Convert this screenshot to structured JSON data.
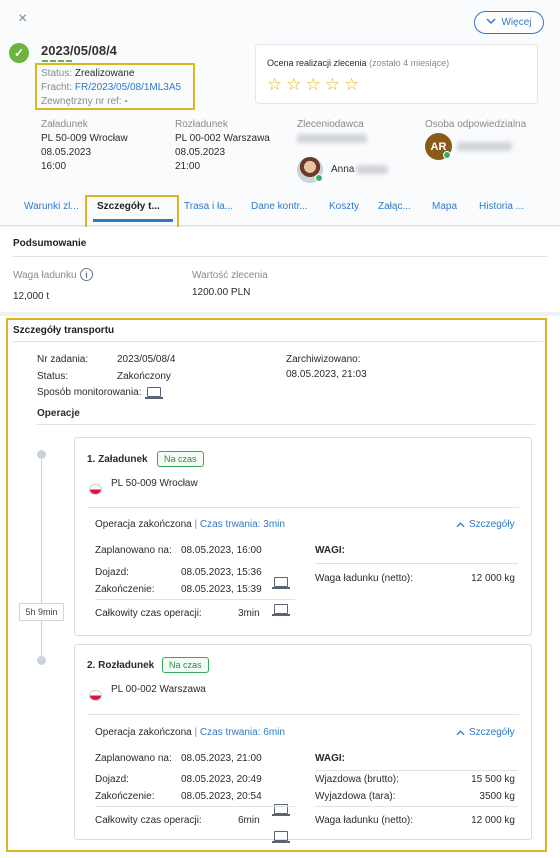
{
  "header": {
    "close_icon": "×",
    "more_label": "Więcej",
    "order_number": "2023/05/08/4",
    "status_label": "Status:",
    "status_value": "Zrealizowane",
    "freight_label": "Fracht:",
    "freight_value": "FR/2023/05/08/1ML3A5",
    "ext_ref_label": "Zewnętrzny nr ref:",
    "ext_ref_value": "-",
    "rating_label": "Ocena realizacji zlecenia",
    "rating_note": "(zostało 4 miesiące)",
    "rating_stars": "☆☆☆☆☆",
    "loading": {
      "label": "Załadunek",
      "address": "PL 50-009 Wrocław",
      "date": "08.05.2023",
      "time": "16:00"
    },
    "unloading": {
      "label": "Rozładunek",
      "address": "PL 00-002 Warszawa",
      "date": "08.05.2023",
      "time": "21:00"
    },
    "principal_label": "Zleceniodawca",
    "principal_person": "Anna",
    "responsible_label": "Osoba odpowiedzialna",
    "responsible_initials": "AR"
  },
  "tabs": [
    {
      "label": "Warunki zl..."
    },
    {
      "label": "Szczegóły t..."
    },
    {
      "label": "Trasa i ła..."
    },
    {
      "label": "Dane kontr..."
    },
    {
      "label": "Koszty"
    },
    {
      "label": "Załąc..."
    },
    {
      "label": "Mapa"
    },
    {
      "label": "Historia ..."
    }
  ],
  "summary": {
    "title": "Podsumowanie",
    "weight_label": "Waga ładunku",
    "weight_value": "12,000 t",
    "value_label": "Wartość zlecenia",
    "value_value": "1200.00 PLN"
  },
  "transport": {
    "title": "Szczegóły transportu",
    "task_no_label": "Nr zadania:",
    "task_no_value": "2023/05/08/4",
    "status_label": "Status:",
    "status_value": "Zakończony",
    "monitoring_label": "Sposób monitorowania:",
    "archived_label": "Zarchiwizowano:",
    "archived_value": "08.05.2023, 21:03",
    "operations_title": "Operacje",
    "duration_between": "5h 9min"
  },
  "operations": [
    {
      "title": "1. Załadunek",
      "badge": "Na czas",
      "address": "PL 50-009 Wrocław",
      "completed_label": "Operacja zakończona",
      "duration_text": "Czas trwania: 3min",
      "details_label": "Szczegóły",
      "planned_label": "Zaplanowano na:",
      "planned_value": "08.05.2023, 16:00",
      "arrival_label": "Dojazd:",
      "arrival_value": "08.05.2023, 15:36",
      "end_label": "Zakończenie:",
      "end_value": "08.05.2023, 15:39",
      "total_label": "Całkowity czas operacji:",
      "total_value": "3min",
      "weights_title": "WAGI:",
      "weights": [
        {
          "label": "Waga ładunku (netto):",
          "value": "12 000 kg"
        }
      ]
    },
    {
      "title": "2. Rozładunek",
      "badge": "Na czas",
      "address": "PL 00-002 Warszawa",
      "completed_label": "Operacja zakończona",
      "duration_text": "Czas trwania: 6min",
      "details_label": "Szczegóły",
      "planned_label": "Zaplanowano na:",
      "planned_value": "08.05.2023, 21:00",
      "arrival_label": "Dojazd:",
      "arrival_value": "08.05.2023, 20:49",
      "end_label": "Zakończenie:",
      "end_value": "08.05.2023, 20:54",
      "total_label": "Całkowity czas operacji:",
      "total_value": "6min",
      "weights_title": "WAGI:",
      "weights": [
        {
          "label": "Wjazdowa (brutto):",
          "value": "15 500 kg"
        },
        {
          "label": "Wyjazdowa (tara):",
          "value": "3500 kg"
        },
        {
          "label": "Waga ładunku (netto):",
          "value": "12 000 kg"
        }
      ]
    }
  ],
  "colors": {
    "accent": "#2f7ac7",
    "success": "#6db33f",
    "highlight": "#d9b622"
  }
}
